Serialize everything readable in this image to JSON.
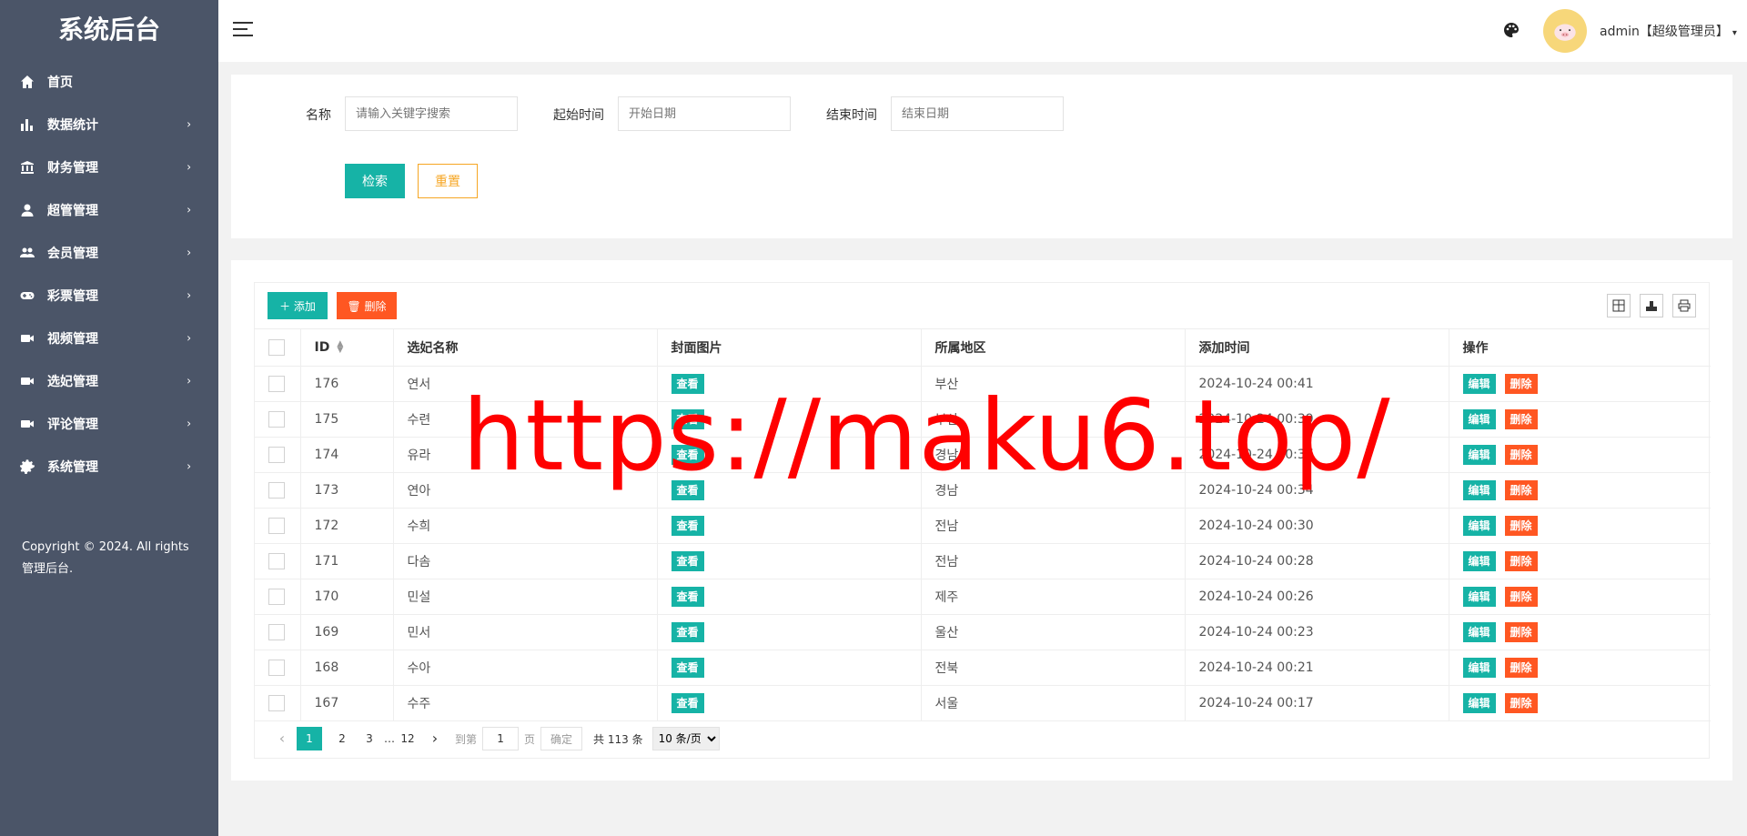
{
  "sidebar": {
    "title": "系统后台",
    "items": [
      {
        "label": "首页",
        "icon": "home-icon",
        "has_arrow": false
      },
      {
        "label": "数据统计",
        "icon": "bar-chart-icon",
        "has_arrow": true
      },
      {
        "label": "财务管理",
        "icon": "bank-icon",
        "has_arrow": true
      },
      {
        "label": "超管管理",
        "icon": "user-icon",
        "has_arrow": true
      },
      {
        "label": "会员管理",
        "icon": "users-icon",
        "has_arrow": true
      },
      {
        "label": "彩票管理",
        "icon": "gamepad-icon",
        "has_arrow": true
      },
      {
        "label": "视频管理",
        "icon": "video-icon",
        "has_arrow": true
      },
      {
        "label": "选妃管理",
        "icon": "video-icon",
        "has_arrow": true
      },
      {
        "label": "评论管理",
        "icon": "video-icon",
        "has_arrow": true
      },
      {
        "label": "系统管理",
        "icon": "gear-icon",
        "has_arrow": true
      }
    ],
    "arrow": "›",
    "copyright": "Copyright © 2024. All rights 管理后台."
  },
  "header": {
    "user": "admin【超级管理员】",
    "caret": "▾"
  },
  "search": {
    "name_label": "名称",
    "name_placeholder": "请输入关键字搜索",
    "start_label": "起始时间",
    "start_placeholder": "开始日期",
    "end_label": "结束时间",
    "end_placeholder": "结束日期",
    "search_button": "检索",
    "reset_button": "重置"
  },
  "toolbar": {
    "add_button": "添加",
    "delete_button": "删除"
  },
  "table": {
    "columns": [
      "ID",
      "选妃名称",
      "封面图片",
      "所属地区",
      "添加时间",
      "操作"
    ],
    "view_label": "查看",
    "edit_label": "编辑",
    "delete_label": "删除",
    "rows": [
      {
        "id": "176",
        "name": "연서",
        "region": "부산",
        "time": "2024-10-24 00:41"
      },
      {
        "id": "175",
        "name": "수련",
        "region": "부산",
        "time": "2024-10-24 00:39"
      },
      {
        "id": "174",
        "name": "유라",
        "region": "경남",
        "time": "2024-10-24 00:37"
      },
      {
        "id": "173",
        "name": "연아",
        "region": "경남",
        "time": "2024-10-24 00:34"
      },
      {
        "id": "172",
        "name": "수희",
        "region": "전남",
        "time": "2024-10-24 00:30"
      },
      {
        "id": "171",
        "name": "다솜",
        "region": "전남",
        "time": "2024-10-24 00:28"
      },
      {
        "id": "170",
        "name": "민설",
        "region": "제주",
        "time": "2024-10-24 00:26"
      },
      {
        "id": "169",
        "name": "민서",
        "region": "울산",
        "time": "2024-10-24 00:23"
      },
      {
        "id": "168",
        "name": "수아",
        "region": "전북",
        "time": "2024-10-24 00:21"
      },
      {
        "id": "167",
        "name": "수주",
        "region": "서울",
        "time": "2024-10-24 00:17"
      }
    ]
  },
  "pagination": {
    "prev": "‹",
    "pages": [
      "1",
      "2",
      "3"
    ],
    "ellipsis": "…",
    "last_page": "12",
    "next": "›",
    "goto_label": "到第",
    "goto_value": "1",
    "page_unit": "页",
    "confirm": "确定",
    "total": "共 113 条",
    "page_size": "10 条/页"
  },
  "watermark": "https://maku6.top/",
  "colors": {
    "sidebar_bg": "#4b5568",
    "primary": "#16b3a6",
    "danger": "#ff5722",
    "warning": "#f6a623"
  }
}
